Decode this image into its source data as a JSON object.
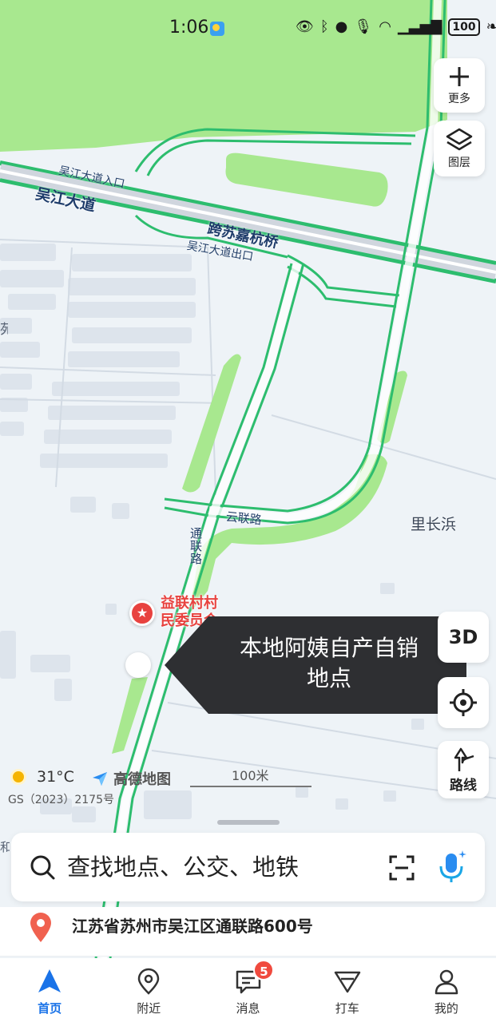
{
  "status_bar": {
    "time": "1:06",
    "battery": "100",
    "icons": [
      "eye-icon",
      "bluetooth-icon",
      "location-icon",
      "mic-icon",
      "wifi-icon",
      "5g-signal-icon",
      "battery-icon",
      "leaf-icon"
    ]
  },
  "map": {
    "road_labels": {
      "wujiang_avenue": "吴江大道",
      "wujiang_entrance": "吴江大道入口",
      "wujiang_exit": "吴江大道出口",
      "bridge": "跨苏嘉杭桥",
      "yunlian_road": "云联路",
      "tonglian_road": "通联路",
      "lichangbang": "里长浜",
      "edge_fragment_left": "苑",
      "edge_fragment_bottom": "和"
    },
    "poi": {
      "name_line1": "益联村村",
      "name_line2": "民委员会"
    },
    "tooltip": {
      "line1": "本地阿姨自产自销",
      "line2": "地点"
    },
    "weather": {
      "temperature": "31°C",
      "icon": "sun-icon"
    },
    "brand": "高德地图",
    "license": "GS（2023）2175号",
    "scale": "100米",
    "colors": {
      "green_area": "#a8e88f",
      "road_outline": "#2dbd6e",
      "background": "#eef3f7"
    }
  },
  "controls": {
    "more_label": "更多",
    "layers_label": "图层",
    "three_d_label": "3D",
    "route_label": "路线"
  },
  "search": {
    "placeholder": "查找地点、公交、地铁"
  },
  "address": {
    "text": "江苏省苏州市吴江区通联路600号"
  },
  "tabs": [
    {
      "label": "首页",
      "icon": "navigation-arrow-icon",
      "active": true
    },
    {
      "label": "附近",
      "icon": "nearby-pin-icon"
    },
    {
      "label": "消息",
      "icon": "message-icon",
      "badge": "5"
    },
    {
      "label": "打车",
      "icon": "taxi-icon"
    },
    {
      "label": "我的",
      "icon": "profile-icon"
    }
  ],
  "accent_color": "#1a73e8"
}
